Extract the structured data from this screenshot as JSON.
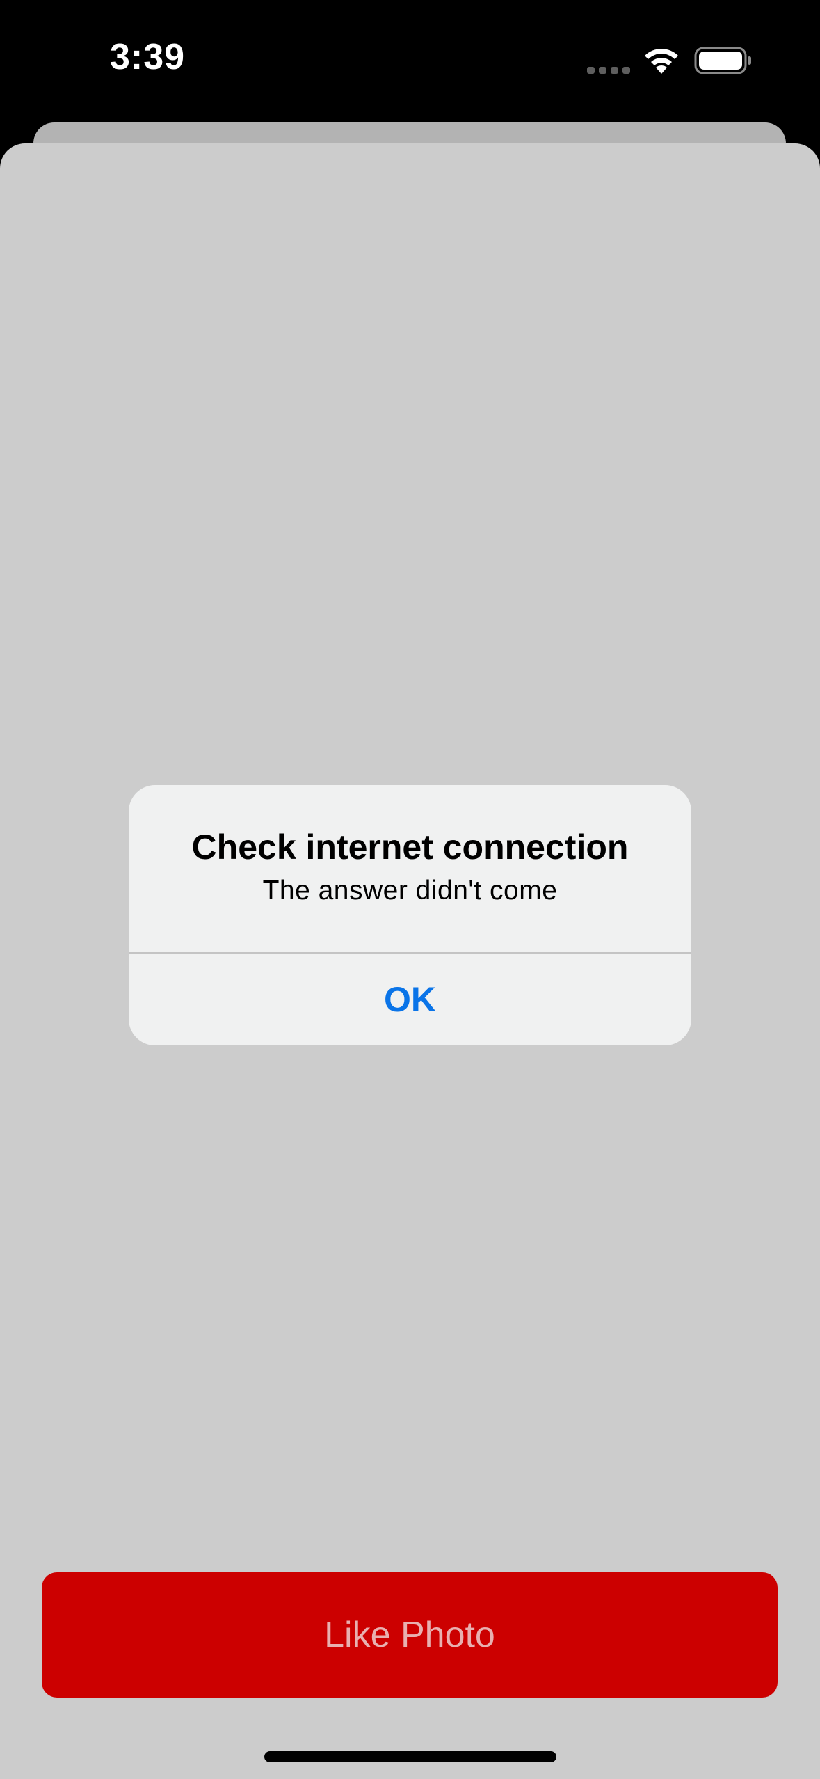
{
  "status_bar": {
    "time": "3:39",
    "signal_icon": "cellular-signal-dots-icon",
    "wifi_icon": "wifi-icon",
    "battery_icon": "battery-icon"
  },
  "alert": {
    "title": "Check internet connection",
    "message": "The answer didn't come",
    "ok_label": "OK"
  },
  "main": {
    "like_button_label": "Like Photo"
  },
  "colors": {
    "accent_blue": "#0a74e8",
    "like_button_red": "#cc0000",
    "sheet_gray": "#cccccc",
    "alert_background": "#f0f1f1"
  }
}
